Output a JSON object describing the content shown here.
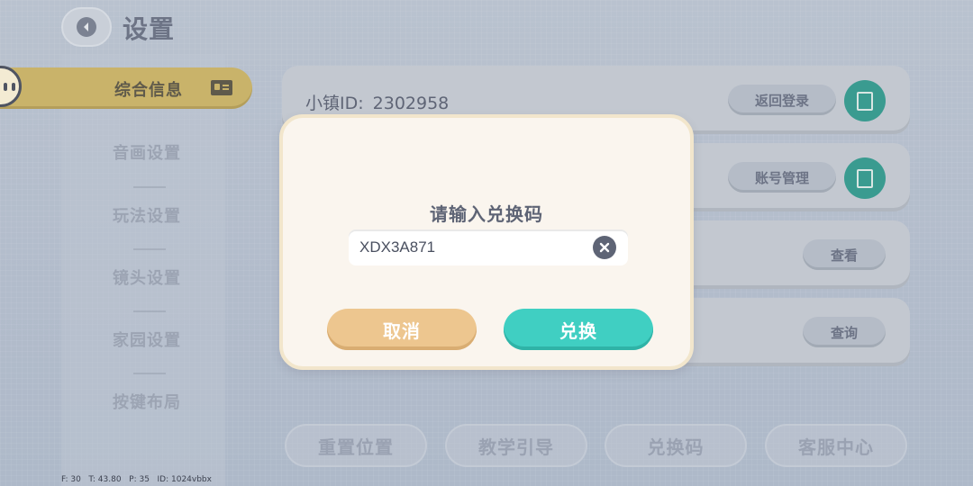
{
  "header": {
    "title": "设置"
  },
  "sidebar": {
    "items": [
      {
        "label": "综合信息",
        "active": true
      },
      {
        "label": "音画设置"
      },
      {
        "label": "玩法设置"
      },
      {
        "label": "镜头设置"
      },
      {
        "label": "家园设置"
      },
      {
        "label": "按键布局"
      }
    ]
  },
  "content": {
    "town_id_label": "小镇ID:",
    "town_id_value": "2302958",
    "rows": [
      {
        "action": "返回登录",
        "copy_icon": "copy-icon"
      },
      {
        "action": "账号管理",
        "copy_icon": "copy-icon"
      },
      {
        "action": "查看"
      },
      {
        "action": "查询"
      }
    ]
  },
  "bottom_tabs": [
    "重置位置",
    "教学引导",
    "兑换码",
    "客服中心"
  ],
  "debug_text": "F: 30   T: 43.80   P: 35   ID: 1024vbbx",
  "dialog": {
    "title": "请输入兑换码",
    "input_value": "XDX3A871",
    "cancel_label": "取消",
    "confirm_label": "兑换"
  },
  "colors": {
    "accent_teal": "#40cfc2",
    "cancel_orange": "#edc68f",
    "active_tab_gold": "#c9b36a"
  }
}
